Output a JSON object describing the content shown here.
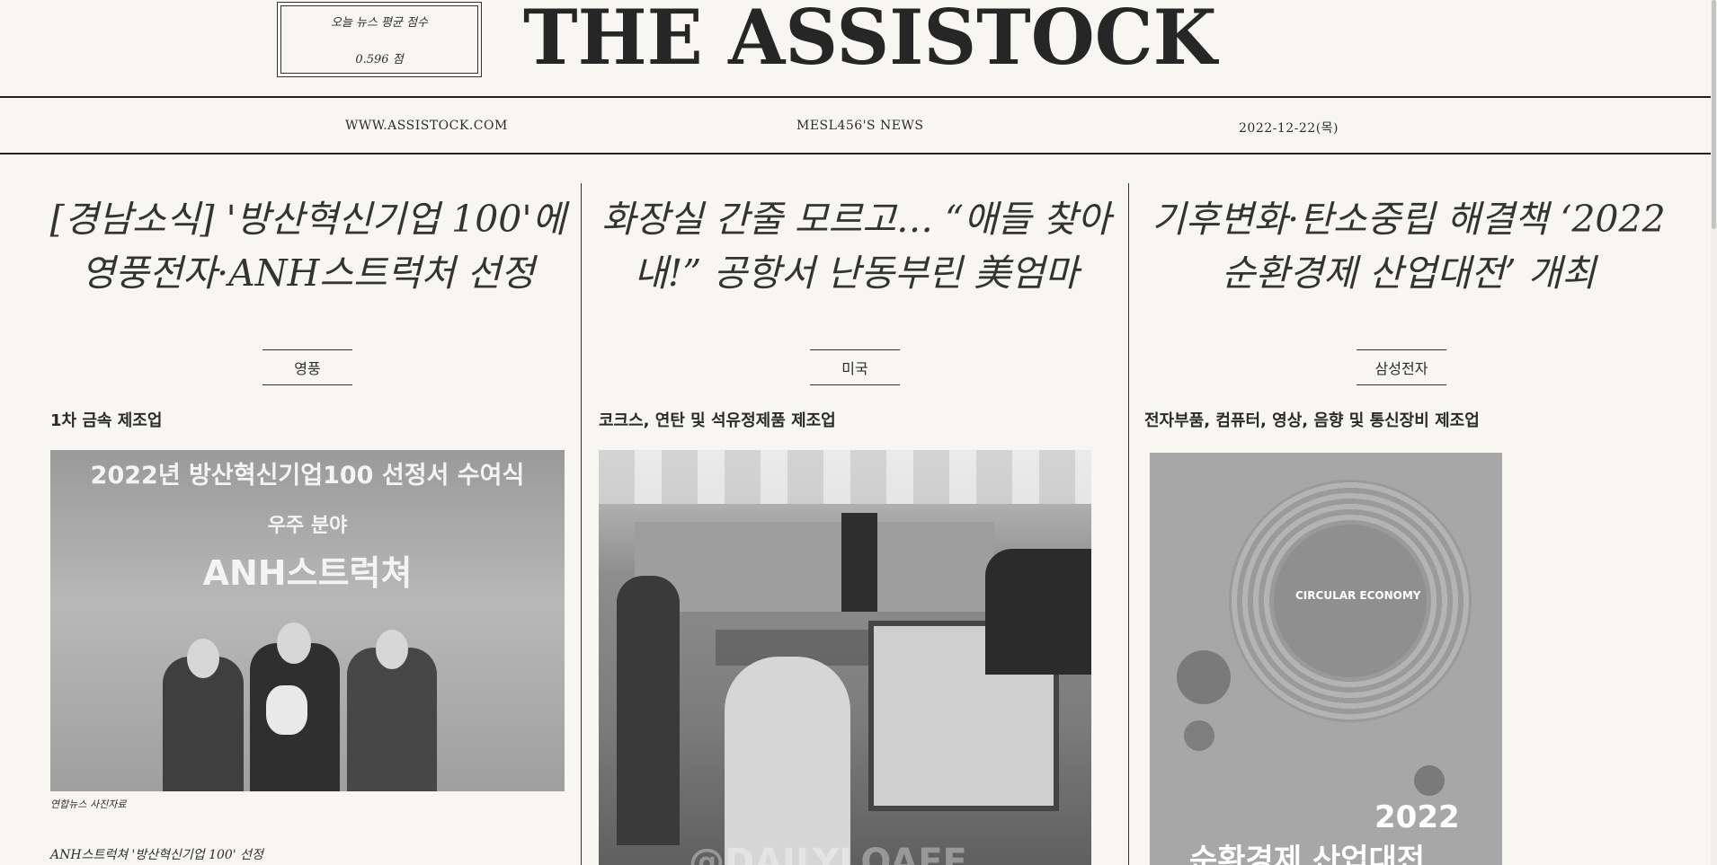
{
  "header": {
    "score_label": "오늘 뉴스 평균 점수",
    "score_value": "0.596 점",
    "brand": "THE ASSISTOCK",
    "site": "WWW.ASSISTOCK.COM",
    "author": "MESL456'S NEWS",
    "date": "2022-12-22(목)"
  },
  "articles": [
    {
      "headline": "[경남소식] '방산혁신기업 100'에 영풍전자·ANH스트럭처 선정",
      "company": "영풍",
      "industry": "1차 금속 제조업",
      "photo_text": [
        "2022년 방산혁신기업100 선정서 수여식",
        "우주 분야",
        "ANH스트럭쳐"
      ],
      "caption": "연합뉴스 사진자료",
      "subline": "ANH스트럭쳐 '방산혁신기업 100' 선정"
    },
    {
      "headline": "화장실 간줄 모르고… “애들 찾아내!” 공항서 난동부린 美엄마",
      "company": "미국",
      "industry": "코크스, 연탄 및 석유정제품 제조업",
      "photo_text": [
        "@DAILYLOAFE"
      ]
    },
    {
      "headline": "기후변화·탄소중립 해결책 ‘2022 순환경제 산업대전’ 개최",
      "company": "삼성전자",
      "industry": "전자부품, 컴퓨터, 영상, 음향 및 통신장비 제조업",
      "photo_text": [
        "CIRCULAR ECONOMY",
        "2022",
        "순환경제 산업대전"
      ]
    }
  ]
}
